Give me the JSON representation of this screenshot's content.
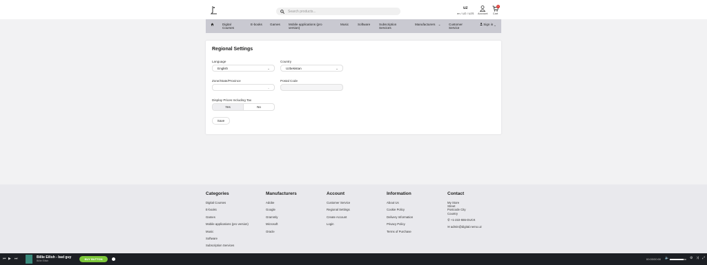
{
  "header": {
    "search_placeholder": "Search products...",
    "locale_flag_alt": "uz",
    "locale_text": "en / UZ / UZS",
    "account_label": "Account",
    "cart_label": "Cart",
    "cart_count": "0"
  },
  "nav": {
    "items": [
      {
        "label": "Digital Courses"
      },
      {
        "label": "E-books"
      },
      {
        "label": "Games"
      },
      {
        "label": "Mobile applications (pro version)"
      },
      {
        "label": "Music"
      },
      {
        "label": "Software"
      },
      {
        "label": "Subscription Services"
      },
      {
        "label": "Manufacturers"
      },
      {
        "label": "Customer Service"
      },
      {
        "label": "Sign in"
      }
    ]
  },
  "form": {
    "title": "Regional Settings",
    "language_label": "Language",
    "language_value": "English",
    "country_label": "Country",
    "country_value": "Uzbekistan",
    "zone_label": "Zone/State/Province",
    "zone_value": "",
    "postal_label": "Postal Code",
    "postal_value": "",
    "tax_label": "Display Prices Including Tax",
    "tax_yes": "Yes",
    "tax_no": "No",
    "tax_selected": "Yes",
    "save_label": "Save"
  },
  "footer": {
    "categories": {
      "title": "Categories",
      "items": [
        "Digital Courses",
        "E-books",
        "Games",
        "Mobile applications (pro version)",
        "Music",
        "Software",
        "Subscription Services"
      ]
    },
    "manufacturers": {
      "title": "Manufacturers",
      "items": [
        "Adobe",
        "Google",
        "Grammly",
        "Microsoft",
        "Oracle"
      ]
    },
    "account": {
      "title": "Account",
      "items": [
        "Customer Service",
        "Regional Settings",
        "Create Account",
        "Login"
      ]
    },
    "information": {
      "title": "Information",
      "items": [
        "About Us",
        "Cookie Policy",
        "Delivery Information",
        "Privacy Policy",
        "Terms of Purchase"
      ]
    },
    "contact": {
      "title": "Contact",
      "address": [
        "My Store",
        "Street",
        "Postcode City",
        "Country"
      ],
      "phone": "+1-222-555-DUCK",
      "email": "admin@digital.nemo.uz"
    }
  },
  "player": {
    "track": "Billie Eilish - bad guy",
    "artist": "Billie Eilish",
    "buy_label": "BUY BUTTON",
    "time": "00:00/00:00",
    "volume": 0.83,
    "accent": "#7cc73a"
  }
}
